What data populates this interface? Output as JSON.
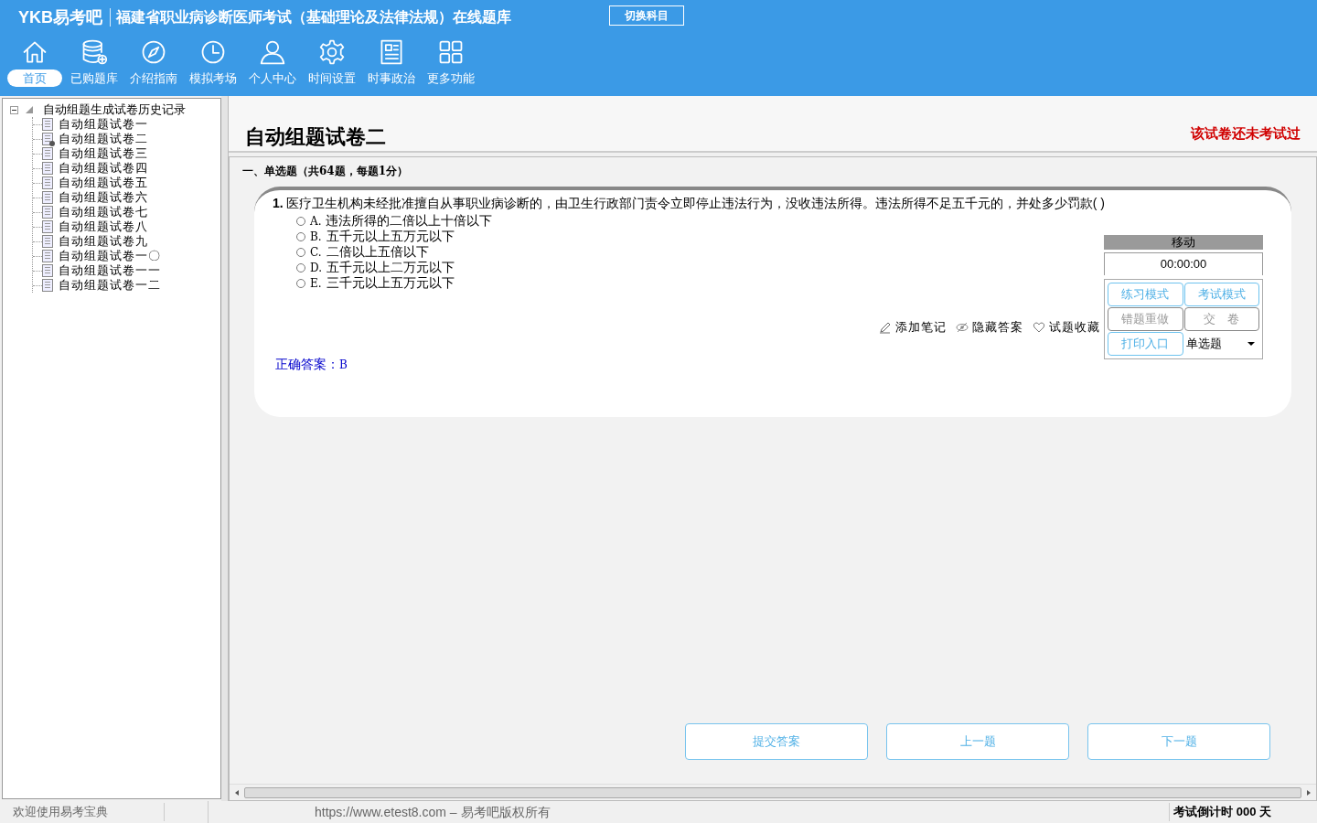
{
  "header": {
    "logo": "YKB易考吧",
    "title": "福建省职业病诊断医师考试（基础理论及法律法规）在线题库",
    "switch_button": "切换科目"
  },
  "nav": [
    {
      "label": "首页",
      "kind": "home",
      "selected": true
    },
    {
      "label": "已购题库",
      "kind": "database",
      "selected": false
    },
    {
      "label": "介绍指南",
      "kind": "compass",
      "selected": false
    },
    {
      "label": "模拟考场",
      "kind": "clock",
      "selected": false
    },
    {
      "label": "个人中心",
      "kind": "user",
      "selected": false
    },
    {
      "label": "时间设置",
      "kind": "gear",
      "selected": false
    },
    {
      "label": "时事政治",
      "kind": "news",
      "selected": false
    },
    {
      "label": "更多功能",
      "kind": "grid",
      "selected": false
    }
  ],
  "tree": {
    "label": "自动组题生成试卷历史记录",
    "expanded": true,
    "children": [
      {
        "label": "自动组题试卷一",
        "selected": false
      },
      {
        "label": "自动组题试卷二",
        "selected": true
      },
      {
        "label": "自动组题试卷三",
        "selected": false
      },
      {
        "label": "自动组题试卷四",
        "selected": false
      },
      {
        "label": "自动组题试卷五",
        "selected": false
      },
      {
        "label": "自动组题试卷六",
        "selected": false
      },
      {
        "label": "自动组题试卷七",
        "selected": false
      },
      {
        "label": "自动组题试卷八",
        "selected": false
      },
      {
        "label": "自动组题试卷九",
        "selected": false
      },
      {
        "label": "自动组题试卷一〇",
        "selected": false
      },
      {
        "label": "自动组题试卷一一",
        "selected": false
      },
      {
        "label": "自动组题试卷一二",
        "selected": false
      }
    ]
  },
  "paper": {
    "title": "自动组题试卷二",
    "status": "该试卷还未考试过",
    "section": "一、单选题（共64题，每题1分）"
  },
  "question": {
    "number": "1.",
    "text": "医疗卫生机构未经批准擅自从事职业病诊断的，由卫生行政部门责令立即停止违法行为，没收违法所得。违法所得不足五千元的，并处多少罚款( )",
    "options": [
      {
        "letter": "A.",
        "text": "违法所得的二倍以上十倍以下",
        "selected": false
      },
      {
        "letter": "B.",
        "text": "五千元以上五万元以下",
        "selected": false
      },
      {
        "letter": "C.",
        "text": "二倍以上五倍以下",
        "selected": false
      },
      {
        "letter": "D.",
        "text": "五千元以上二万元以下",
        "selected": false
      },
      {
        "letter": "E.",
        "text": "三千元以上五万元以下",
        "selected": false
      }
    ],
    "actions": [
      {
        "label": "添加笔记",
        "kind": "pencil"
      },
      {
        "label": "隐藏答案",
        "kind": "eye"
      },
      {
        "label": "试题收藏",
        "kind": "heart"
      }
    ],
    "answer_label": "正确答案：",
    "answer": "B"
  },
  "panel": {
    "title": "移动",
    "timer": "00:00:00",
    "buttons": [
      {
        "label": "练习模式",
        "disabled": false
      },
      {
        "label": "考试模式",
        "disabled": false
      },
      {
        "label": "错题重做",
        "disabled": true
      },
      {
        "label": "交　卷",
        "disabled": true
      },
      {
        "label": "打印入口",
        "disabled": false
      }
    ],
    "type_select": "单选题"
  },
  "bottom_buttons": [
    "提交答案",
    "上一题",
    "下一题"
  ],
  "status_bar": {
    "welcome": "欢迎使用易考宝典",
    "copyright": "https://www.etest8.com – 易考吧版权所有",
    "countdown": "考试倒计时 000 天"
  }
}
